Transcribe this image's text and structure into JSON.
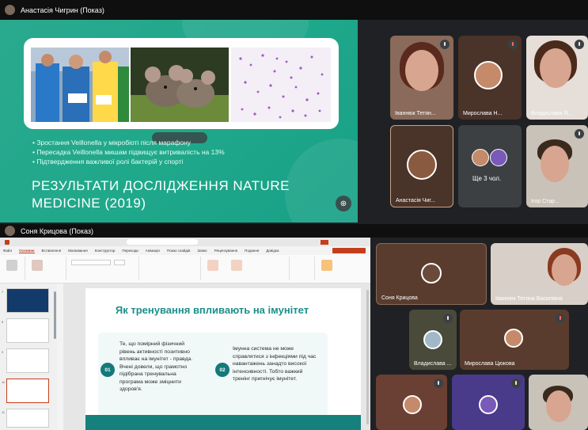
{
  "top_window": {
    "title": "Анастасія Чигрин (Показ)"
  },
  "slide1": {
    "bullets": [
      "• Зростання Veillonella у мікробіоті після марафону",
      "• Пересадка Veillonella мишам підвищує витривалість на 13%",
      "• Підтвердження важливої ролі бактерій у спорті"
    ],
    "title_line1": "РЕЗУЛЬТАТИ ДОСЛІДЖЕННЯ NATURE",
    "title_line2": "MEDICINE (2019)"
  },
  "top_participants": [
    {
      "name": "Іваннюк Тетян..."
    },
    {
      "name": "Мирослава Н..."
    },
    {
      "name": "Владислава Я..."
    },
    {
      "name": "Анастасія Чиг..."
    },
    {
      "name": "Ще 3 чол."
    },
    {
      "name": "Ігор Стар..."
    }
  ],
  "bottom_window": {
    "title": "Соня Крицова (Показ)"
  },
  "ppt": {
    "tabs": [
      "Файл",
      "Основне",
      "Вставлення",
      "Малювання",
      "Конструктор",
      "Переходи",
      "Анімація",
      "Показ слайдів",
      "Запис",
      "Рецензування",
      "Подання",
      "Довідка"
    ],
    "active_tab": "Основне",
    "slide_title": "Як тренування впливають на імунітет",
    "item1_num": "01",
    "item1_text": "Те, що помірний фізичний рівень активності позитивно впливає на імунітет - правда. Вчені довели, що грамотно підібрана тренувальна програма може зміцнити здоров'я.",
    "item2_num": "02",
    "item2_text": "Імунна система не може справлятися з інфекціями під час навантажень занадто високої інтенсивності. Тобто важкий тренінг пригнічує імунітет."
  },
  "bottom_participants": [
    {
      "name": "Соня Крицова"
    },
    {
      "name": "Іваннюк Тетяна Василівна"
    },
    {
      "name": "Владислава ..."
    },
    {
      "name": "Мирослава Цюкова"
    }
  ]
}
